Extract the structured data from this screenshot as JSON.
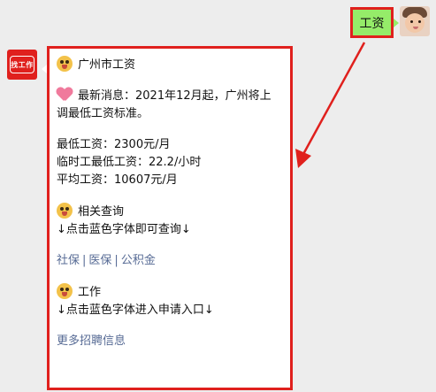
{
  "chat": {
    "user_message": "工资",
    "bot_avatar_label": "找工作",
    "bot_message": {
      "title": "广州市工资",
      "news_prefix": "最新消息：",
      "news_line1": "2021年12月起，广州将上",
      "news_line2": "调最低工资标准。",
      "min_wage": "最低工资：2300元/月",
      "temp_min_wage": "临时工最低工资：22.2/小时",
      "avg_wage": "平均工资：10607元/月",
      "related_title": "相关查询",
      "related_hint": "↓点击蓝色字体即可查询↓",
      "links": [
        "社保",
        "医保",
        "公积金"
      ],
      "work_title": "工作",
      "work_hint": "↓点击蓝色字体进入申请入口↓",
      "more_link": "更多招聘信息"
    }
  },
  "colors": {
    "background": "#ededed",
    "user_bubble": "#95ec69",
    "highlight": "#e0201d",
    "link": "#576b95",
    "bot_bubble": "#ffffff"
  },
  "icons": {
    "user_avatar": "baby-face-avatar",
    "bot_avatar": "app-logo-icon",
    "emoji": "face-with-tongue-emoji",
    "heart": "heart-emoji",
    "annotation": "red-arrow"
  }
}
